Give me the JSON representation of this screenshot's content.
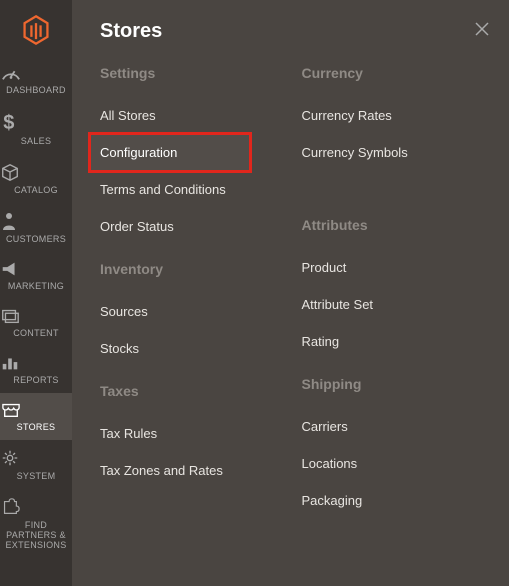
{
  "panel_title": "Stores",
  "sidebar": {
    "items": [
      {
        "label": "DASHBOARD"
      },
      {
        "label": "SALES"
      },
      {
        "label": "CATALOG"
      },
      {
        "label": "CUSTOMERS"
      },
      {
        "label": "MARKETING"
      },
      {
        "label": "CONTENT"
      },
      {
        "label": "REPORTS"
      },
      {
        "label": "STORES"
      },
      {
        "label": "SYSTEM"
      },
      {
        "label": "FIND PARTNERS & EXTENSIONS"
      }
    ]
  },
  "left_col": {
    "groups": [
      {
        "heading": "Settings",
        "items": [
          "All Stores",
          "Configuration",
          "Terms and Conditions",
          "Order Status"
        ]
      },
      {
        "heading": "Inventory",
        "items": [
          "Sources",
          "Stocks"
        ]
      },
      {
        "heading": "Taxes",
        "items": [
          "Tax Rules",
          "Tax Zones and Rates"
        ]
      }
    ]
  },
  "right_col": {
    "groups": [
      {
        "heading": "Currency",
        "items": [
          "Currency Rates",
          "Currency Symbols"
        ]
      },
      {
        "heading": "Attributes",
        "items": [
          "Product",
          "Attribute Set",
          "Rating"
        ]
      },
      {
        "heading": "Shipping",
        "items": [
          "Carriers",
          "Locations",
          "Packaging"
        ]
      }
    ]
  }
}
